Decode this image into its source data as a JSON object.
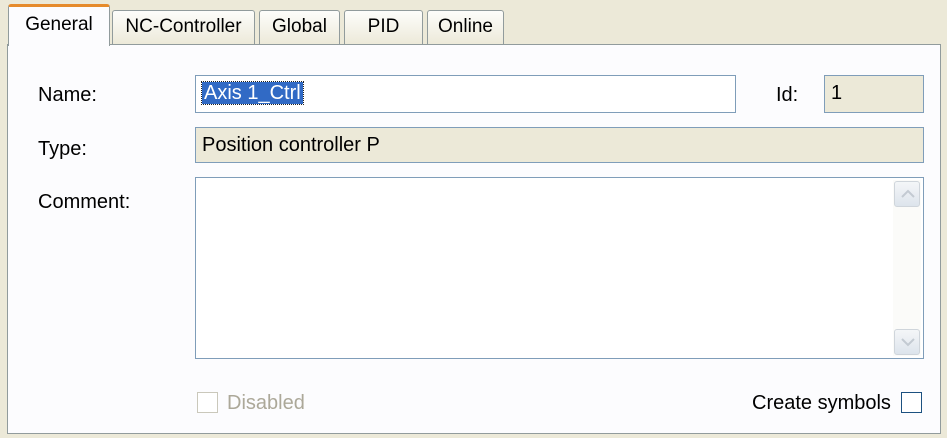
{
  "tabs": [
    {
      "label": "General",
      "active": true
    },
    {
      "label": "NC-Controller",
      "active": false
    },
    {
      "label": "Global",
      "active": false
    },
    {
      "label": "PID",
      "active": false
    },
    {
      "label": "Online",
      "active": false
    }
  ],
  "form": {
    "name_label": "Name:",
    "name_value": "Axis 1_Ctrl",
    "id_label": "Id:",
    "id_value": "1",
    "type_label": "Type:",
    "type_value": "Position controller P",
    "comment_label": "Comment:",
    "comment_value": "",
    "disabled_label": "Disabled",
    "disabled_checked": false,
    "create_symbols_label": "Create symbols",
    "create_symbols_checked": false
  },
  "icons": {
    "scroll_up": "scroll-up-arrow-icon",
    "scroll_down": "scroll-down-arrow-icon"
  },
  "colors": {
    "window_bg": "#ece9d8",
    "panel_bg": "#fcfcfe",
    "active_tab_accent": "#e68b2c",
    "selection_bg": "#316ac5",
    "field_border": "#7f9db9"
  }
}
